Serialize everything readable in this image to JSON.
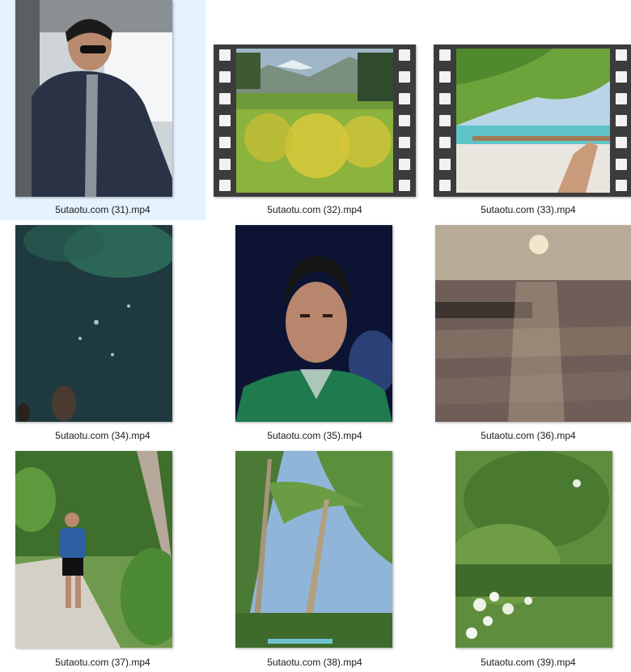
{
  "files": [
    {
      "name": "5utaotu.com (31).mp4",
      "selected": true,
      "style": "plain"
    },
    {
      "name": "5utaotu.com (32).mp4",
      "selected": false,
      "style": "film"
    },
    {
      "name": "5utaotu.com (33).mp4",
      "selected": false,
      "style": "film"
    },
    {
      "name": "5utaotu.com (34).mp4",
      "selected": false,
      "style": "plain"
    },
    {
      "name": "5utaotu.com (35).mp4",
      "selected": false,
      "style": "plain"
    },
    {
      "name": "5utaotu.com (36).mp4",
      "selected": false,
      "style": "plain"
    },
    {
      "name": "5utaotu.com (37).mp4",
      "selected": false,
      "style": "plain"
    },
    {
      "name": "5utaotu.com (38).mp4",
      "selected": false,
      "style": "plain"
    },
    {
      "name": "5utaotu.com (39).mp4",
      "selected": false,
      "style": "plain"
    }
  ],
  "colors": {
    "selection_bg": "#e5f3ff",
    "film_strip": "#3c3c3c",
    "label_text": "#1a1a1a"
  }
}
